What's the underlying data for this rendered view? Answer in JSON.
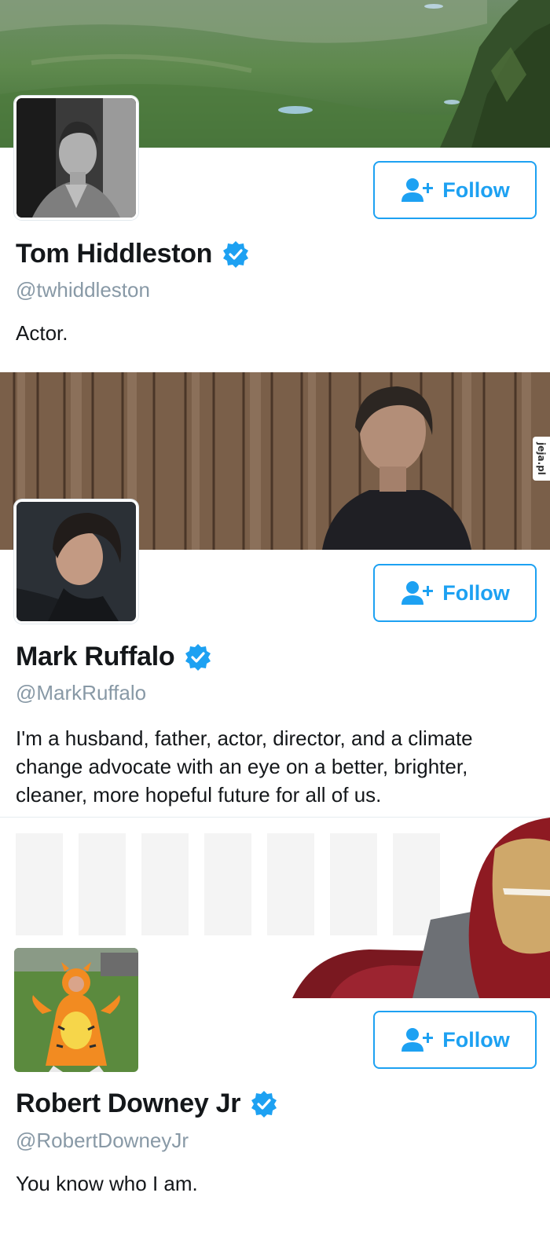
{
  "profiles": [
    {
      "name": "Tom Hiddleston",
      "handle": "@twhiddleston",
      "bio": "Actor.",
      "follow_label": "Follow",
      "verified": true
    },
    {
      "name": "Mark Ruffalo",
      "handle": "@MarkRuffalo",
      "bio": "I'm a husband, father, actor, director, and a climate change advocate with an eye on a better, brighter, cleaner, more hopeful future for all of us.",
      "follow_label": "Follow",
      "verified": true
    },
    {
      "name": "Robert Downey Jr",
      "handle": "@RobertDowneyJr",
      "bio": "You know who I am.",
      "follow_label": "Follow",
      "verified": true
    }
  ],
  "watermark": "jeja.pl",
  "colors": {
    "accent": "#1da1f2",
    "verified": "#1da1f2",
    "handle": "#8899a6",
    "text": "#14171a"
  },
  "icons": {
    "follow": "add-user-icon",
    "verified": "verified-badge-icon"
  }
}
